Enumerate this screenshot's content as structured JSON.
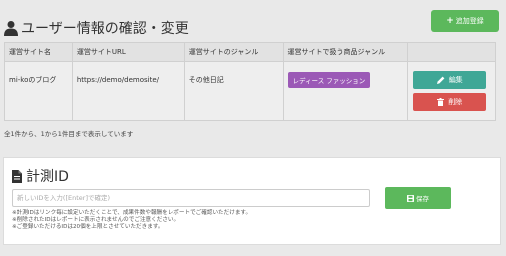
{
  "header": {
    "title": "ユーザー情報の確認・変更",
    "add_button_label": "追加登録"
  },
  "table": {
    "columns": [
      "運営サイト名",
      "運営サイトURL",
      "運営サイトのジャンル",
      "運営サイトで扱う商品ジャンル",
      ""
    ],
    "rows": [
      {
        "name": "mi-koのブログ",
        "url": "https://demo/demosite/",
        "genre": "その他日記",
        "product_genre": "レディース ファッション",
        "edit_label": "編集",
        "delete_label": "削除"
      }
    ]
  },
  "summary": "全1件から、1から1件目まで表示しています",
  "measure": {
    "title": "計測ID",
    "input_placeholder": "新しいIDを入力([Enter]で確定)",
    "save_label": "保存",
    "notes": [
      "※計測IDはリンク毎に設定いただくことで、成果件数や報酬をレポートでご確認いただけます。",
      "※削除されたIDはレポートに表示されませんのでご注意ください。",
      "※ご登録いただけるIDは20個を上限とさせていただきます。"
    ]
  },
  "colors": {
    "green": "#5cb85c",
    "teal": "#3fa796",
    "red": "#d9534f",
    "purple": "#9b59b6"
  },
  "icons": [
    "user-icon",
    "plus-icon",
    "pencil-icon",
    "trash-icon",
    "document-icon",
    "save-icon"
  ]
}
